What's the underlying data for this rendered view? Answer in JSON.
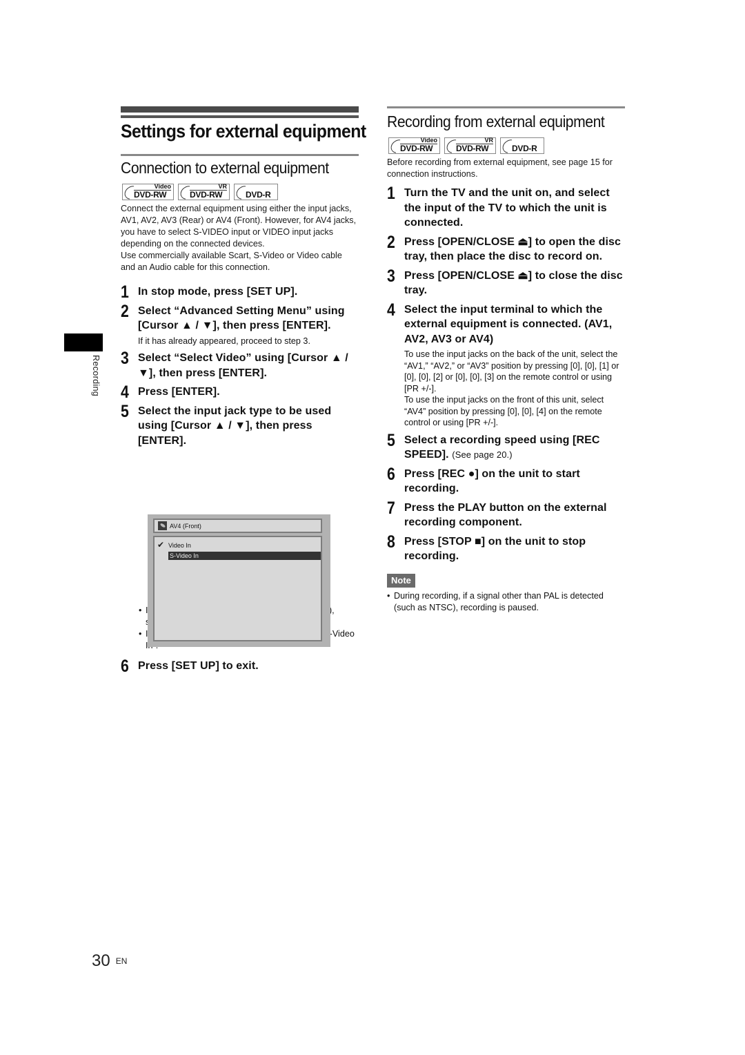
{
  "page": {
    "title": "Settings for external equipment",
    "side_tab_label": "Recording",
    "page_number": "30",
    "language": "EN"
  },
  "disc_badges": [
    {
      "sup": "Video",
      "main": "DVD-RW"
    },
    {
      "sup": "VR",
      "main": "DVD-RW"
    },
    {
      "sup": "",
      "main": "DVD-R"
    }
  ],
  "left": {
    "section_title": "Connection to external equipment",
    "intro": [
      "Connect the external equipment using either the input jacks, AV1, AV2, AV3 (Rear) or AV4 (Front). However, for AV4 jacks, you have to select S-VIDEO input or VIDEO input jacks depending on the connected devices.",
      "Use commercially available Scart, S-Video or Video cable and an Audio cable for this connection."
    ],
    "steps": [
      {
        "num": "1",
        "text": "In stop mode, press [SET UP]."
      },
      {
        "num": "2",
        "text": "Select “Advanced Setting Menu” using [Cursor ▲ / ▼], then press [ENTER].",
        "sub": "If it has already appeared, proceed to step 3."
      },
      {
        "num": "3",
        "text": "Select “Select Video” using [Cursor ▲ / ▼], then press [ENTER]."
      },
      {
        "num": "4",
        "text": "Press [ENTER]."
      },
      {
        "num": "5",
        "text": "Select the input jack type to be used using [Cursor ▲ / ▼], then press [ENTER]."
      },
      {
        "num": "6",
        "text": "Press [SET UP] to exit."
      }
    ],
    "osd": {
      "header": "AV4 (Front)",
      "items": [
        "Video In",
        "S-Video In"
      ],
      "checked_item": "Video In",
      "highlighted_item": "S-Video In"
    },
    "bullets": [
      "If you want to use VIDEO input jack (Composite), select “Video In”.",
      "If you want to use S-VIDEO input jack, select “S-Video In”."
    ]
  },
  "right": {
    "section_title": "Recording from external equipment",
    "intro": "Before recording from external equipment, see page 15 for connection instructions.",
    "steps": [
      {
        "num": "1",
        "text": "Turn the TV and the unit on, and select the input of the TV to which the unit is connected."
      },
      {
        "num": "2",
        "text": "Press [OPEN/CLOSE ⏏] to open the disc tray, then place the disc to record on."
      },
      {
        "num": "3",
        "text": "Press [OPEN/CLOSE ⏏] to close the disc tray."
      },
      {
        "num": "4",
        "text": "Select the input terminal to which the external equipment is connected. (AV1, AV2, AV3 or AV4)",
        "sub1": "To use the input jacks on the back of the unit, select the “AV1,” “AV2,” or “AV3” position by pressing [0], [0], [1] or [0], [0], [2] or [0], [0], [3] on the remote control or using [PR +/-].",
        "sub2": "To use the input jacks on the front of this unit, select “AV4” position by pressing [0], [0], [4] on the remote control or using [PR +/-]."
      },
      {
        "num": "5",
        "text": "Select a recording speed using [REC SPEED].",
        "inline_small": "(See page 20.)"
      },
      {
        "num": "6",
        "text": "Press [REC ●] on the unit to start recording."
      },
      {
        "num": "7",
        "text": "Press the PLAY button on the external recording component."
      },
      {
        "num": "8",
        "text": "Press [STOP ■] on the unit to stop recording."
      }
    ],
    "note_label": "Note",
    "notes": [
      "During recording, if a signal other than PAL is detected (such as NTSC), recording is paused."
    ]
  }
}
